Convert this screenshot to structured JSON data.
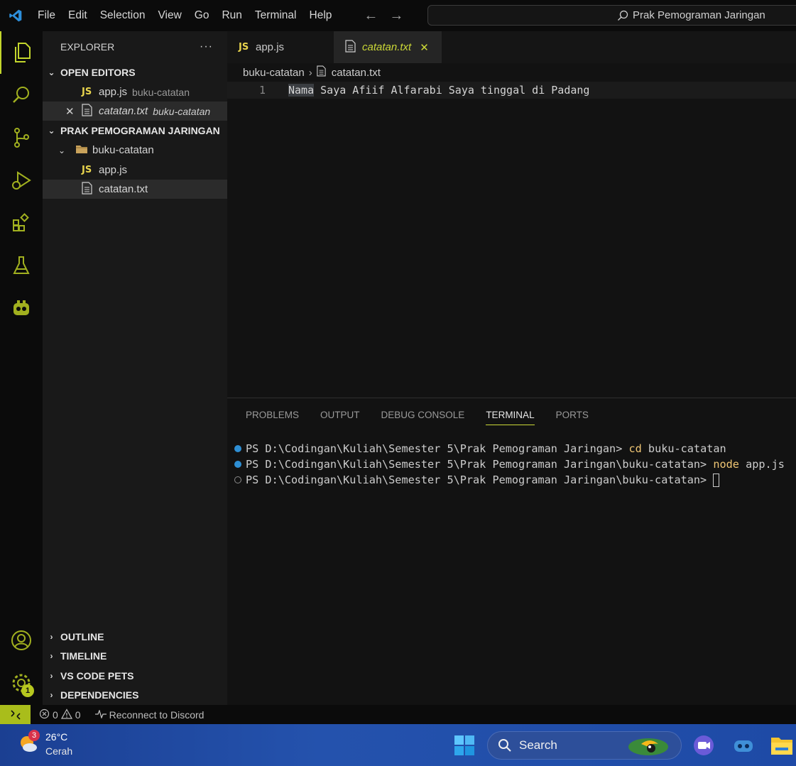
{
  "titlebar": {
    "menu": [
      "File",
      "Edit",
      "Selection",
      "View",
      "Go",
      "Run",
      "Terminal",
      "Help"
    ],
    "search_text": "Prak Pemograman Jaringan"
  },
  "sidebar": {
    "title": "EXPLORER",
    "more": "···",
    "open_editors_label": "OPEN EDITORS",
    "open_editors": [
      {
        "icon": "JS",
        "name": "app.js",
        "folder": "buku-catatan"
      },
      {
        "name": "catatan.txt",
        "folder": "buku-catatan"
      }
    ],
    "project_label": "PRAK PEMOGRAMAN JARINGAN",
    "folder": "buku-catatan",
    "files": [
      {
        "icon": "JS",
        "name": "app.js"
      },
      {
        "name": "catatan.txt"
      }
    ],
    "bottom_sections": [
      "OUTLINE",
      "TIMELINE",
      "VS CODE PETS",
      "DEPENDENCIES"
    ]
  },
  "editor": {
    "tabs": [
      {
        "icon": "JS",
        "name": "app.js"
      },
      {
        "name": "catatan.txt",
        "close": "✕"
      }
    ],
    "breadcrumb": {
      "folder": "buku-catatan",
      "file": "catatan.txt"
    },
    "lines": [
      {
        "num": "1",
        "selected": "Nama",
        "rest": " Saya Afiif Alfarabi Saya tinggal di Padang"
      }
    ]
  },
  "panel": {
    "tabs": [
      "PROBLEMS",
      "OUTPUT",
      "DEBUG CONSOLE",
      "TERMINAL",
      "PORTS"
    ],
    "terminal": [
      {
        "prompt": "PS D:\\Codingan\\Kuliah\\Semester 5\\Prak Pemograman Jaringan> ",
        "cmd": "cd",
        "args": " buku-catatan"
      },
      {
        "prompt": "PS D:\\Codingan\\Kuliah\\Semester 5\\Prak Pemograman Jaringan\\buku-catatan> ",
        "cmd": "node",
        "args": " app.js"
      },
      {
        "prompt": "PS D:\\Codingan\\Kuliah\\Semester 5\\Prak Pemograman Jaringan\\buku-catatan> ",
        "cmd": "",
        "args": ""
      }
    ]
  },
  "statusbar": {
    "errors": "0",
    "warnings": "0",
    "discord": "Reconnect to Discord"
  },
  "activity": {
    "settings_badge": "1"
  },
  "taskbar": {
    "weather_badge": "3",
    "temperature": "26°C",
    "condition": "Cerah",
    "search": "Search"
  }
}
